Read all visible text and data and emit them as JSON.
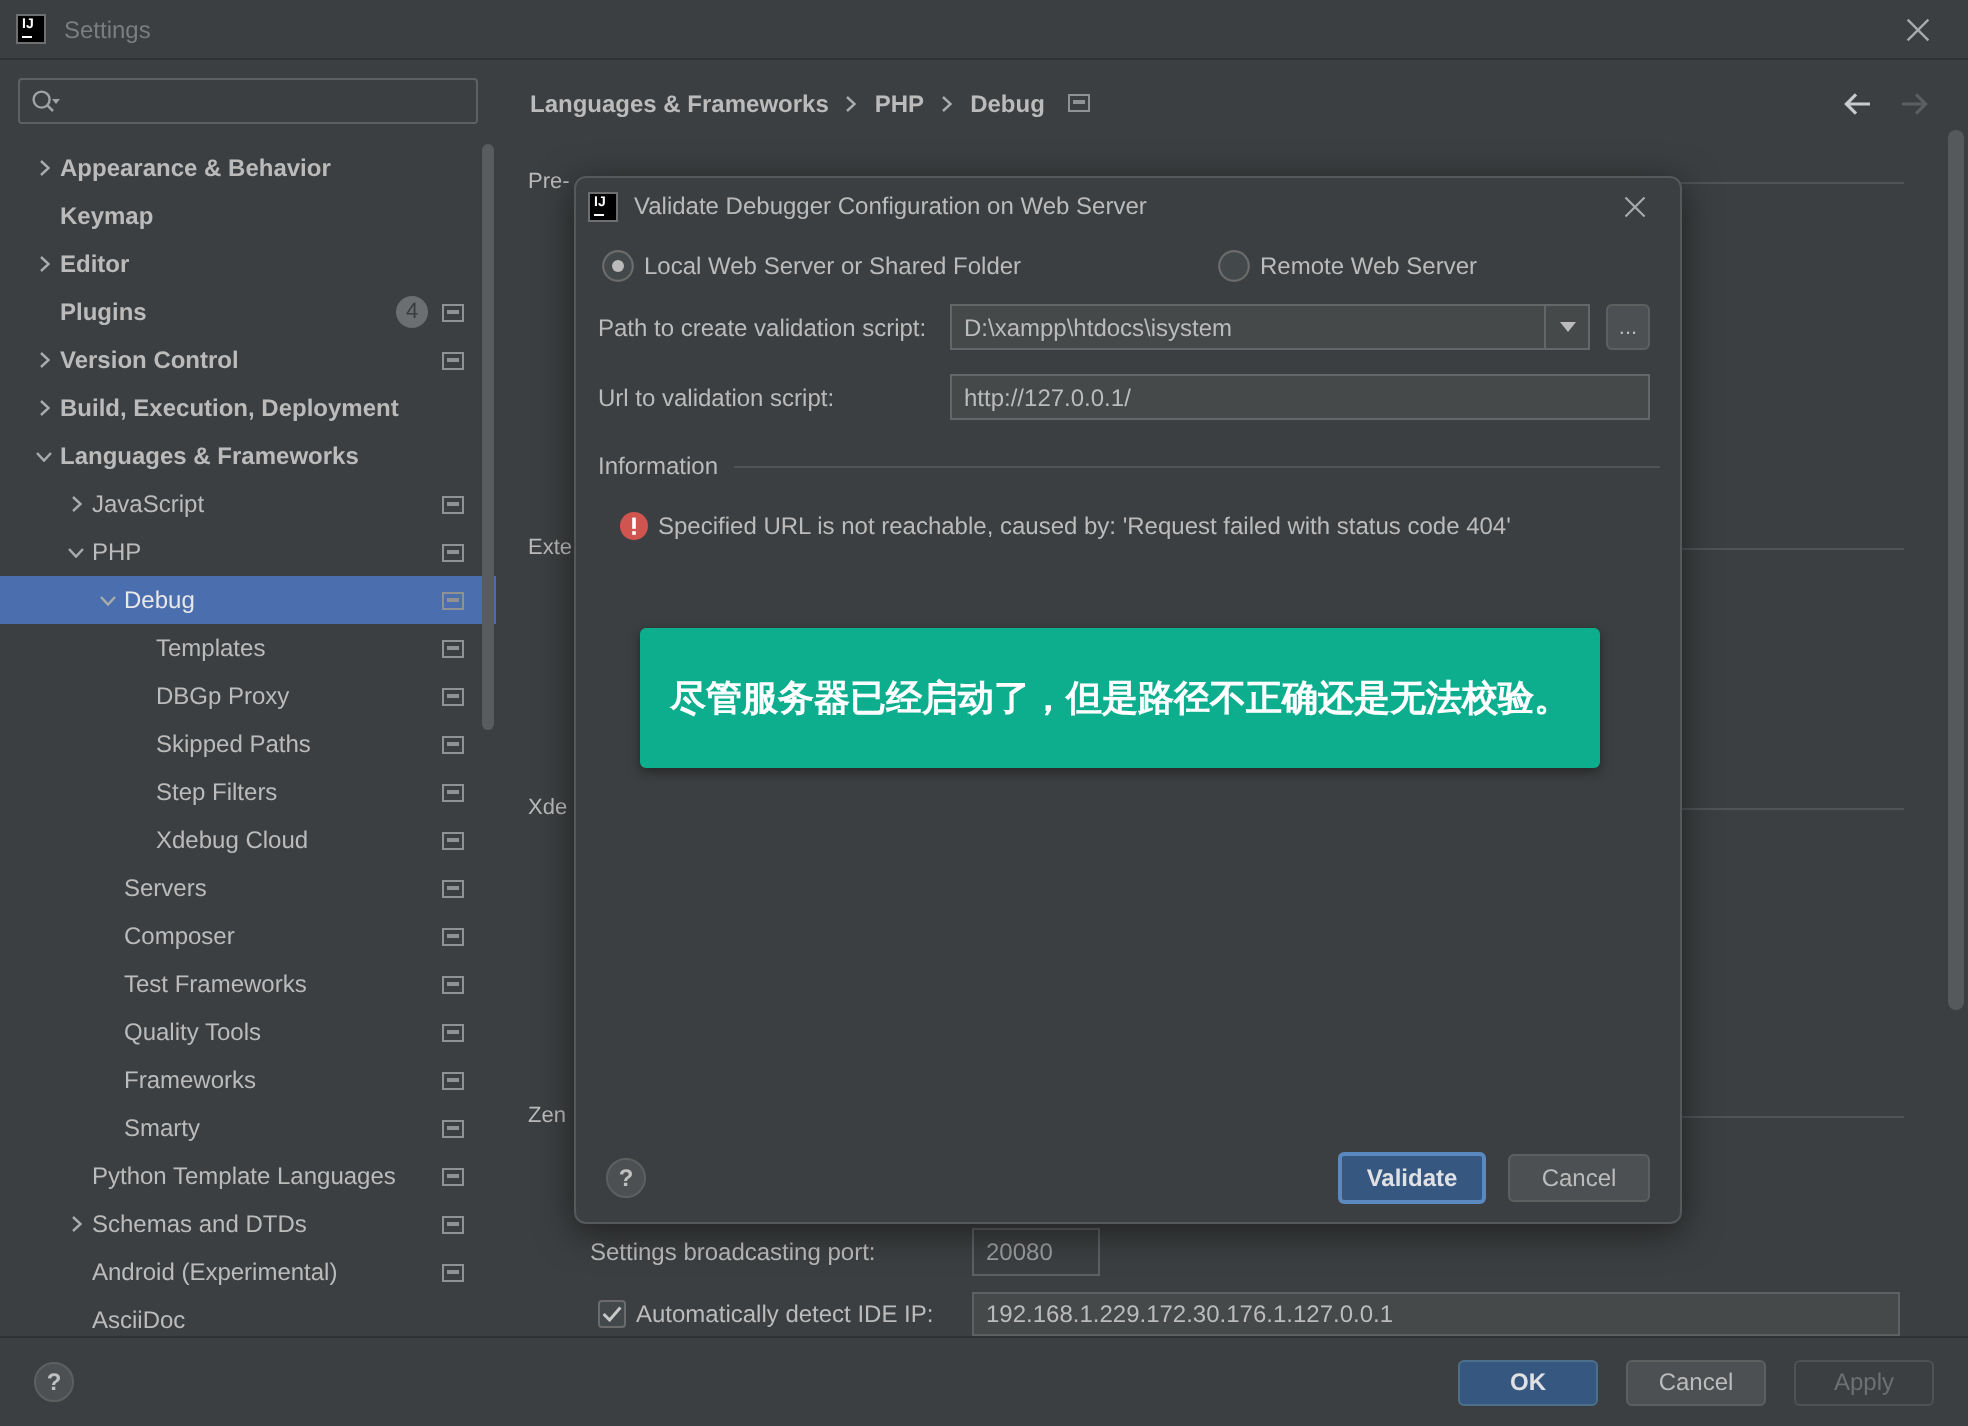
{
  "window": {
    "logo": "IJ",
    "title": "Settings"
  },
  "sidebar": {
    "tree": [
      {
        "label": "Appearance & Behavior",
        "expanded": false,
        "selected": false,
        "scope": false
      },
      {
        "label": "Keymap",
        "selected": false,
        "scope": false
      },
      {
        "label": "Editor",
        "expanded": false,
        "selected": false,
        "scope": false
      },
      {
        "label": "Plugins",
        "selected": false,
        "badge": "4",
        "scope": true
      },
      {
        "label": "Version Control",
        "expanded": false,
        "selected": false,
        "scope": true
      },
      {
        "label": "Build, Execution, Deployment",
        "expanded": false,
        "selected": false,
        "scope": false
      },
      {
        "label": "Languages & Frameworks",
        "expanded": true,
        "selected": false,
        "scope": false,
        "children": [
          {
            "label": "JavaScript",
            "expanded": false,
            "selected": false,
            "scope": true
          },
          {
            "label": "PHP",
            "expanded": true,
            "selected": false,
            "scope": true,
            "children": [
              {
                "label": "Debug",
                "expanded": true,
                "selected": true,
                "scope": true,
                "children": [
                  {
                    "label": "Templates",
                    "selected": false,
                    "scope": true
                  },
                  {
                    "label": "DBGp Proxy",
                    "selected": false,
                    "scope": true
                  },
                  {
                    "label": "Skipped Paths",
                    "selected": false,
                    "scope": true
                  },
                  {
                    "label": "Step Filters",
                    "selected": false,
                    "scope": true
                  },
                  {
                    "label": "Xdebug Cloud",
                    "selected": false,
                    "scope": true
                  }
                ]
              },
              {
                "label": "Servers",
                "selected": false,
                "scope": true
              },
              {
                "label": "Composer",
                "selected": false,
                "scope": true
              },
              {
                "label": "Test Frameworks",
                "selected": false,
                "scope": true
              },
              {
                "label": "Quality Tools",
                "selected": false,
                "scope": true
              },
              {
                "label": "Frameworks",
                "selected": false,
                "scope": true
              },
              {
                "label": "Smarty",
                "selected": false,
                "scope": true
              }
            ]
          },
          {
            "label": "Python Template Languages",
            "selected": false,
            "scope": true
          },
          {
            "label": "Schemas and DTDs",
            "expanded": false,
            "selected": false,
            "scope": true
          },
          {
            "label": "Android (Experimental)",
            "selected": false,
            "scope": true
          },
          {
            "label": "AsciiDoc",
            "selected": false,
            "scope": false
          }
        ]
      }
    ]
  },
  "breadcrumb": [
    "Languages & Frameworks",
    "PHP",
    "Debug"
  ],
  "navigation": [
    {
      "kind": "back",
      "disabled": false
    },
    {
      "kind": "forward",
      "disabled": true
    }
  ],
  "sections": [
    {
      "title": "Pre-"
    },
    {
      "title": "Exte"
    },
    {
      "title": "Xde"
    },
    {
      "title": "Zen",
      "fields": [
        {
          "kind": "text",
          "label": "Settings broadcasting port:",
          "value": "20080"
        },
        {
          "kind": "checkbox",
          "checked": true,
          "label": "Automatically detect IDE IP:",
          "value": "192.168.1.229.172.30.176.1.127.0.0.1"
        }
      ]
    }
  ],
  "footer": {
    "help": "?",
    "buttons": [
      {
        "label": "OK",
        "kind": "primary",
        "disabled": false
      },
      {
        "label": "Cancel",
        "kind": "default",
        "disabled": false
      },
      {
        "label": "Apply",
        "kind": "default",
        "disabled": true
      }
    ]
  },
  "dialog": {
    "logo": "IJ",
    "title": "Validate Debugger Configuration on Web Server",
    "radios": [
      {
        "label": "Local Web Server or Shared Folder",
        "selected": true
      },
      {
        "label": "Remote Web Server",
        "selected": false
      }
    ],
    "path": {
      "label": "Path to create validation script:",
      "value": "D:\\xampp\\htdocs\\isystem"
    },
    "browse": "...",
    "url": {
      "label": "Url to validation script:",
      "value": "http://127.0.0.1/"
    },
    "section": "Information",
    "message": {
      "kind": "error",
      "text": "Specified URL is not reachable, caused by: 'Request failed with status code 404'"
    },
    "help": "?",
    "buttons": [
      {
        "label": "Validate",
        "kind": "primary",
        "focused": true
      },
      {
        "label": "Cancel",
        "kind": "default",
        "focused": false
      }
    ]
  },
  "annotation": {
    "text": "尽管服务器已经启动了，但是路径不正确还是无法校验。"
  }
}
